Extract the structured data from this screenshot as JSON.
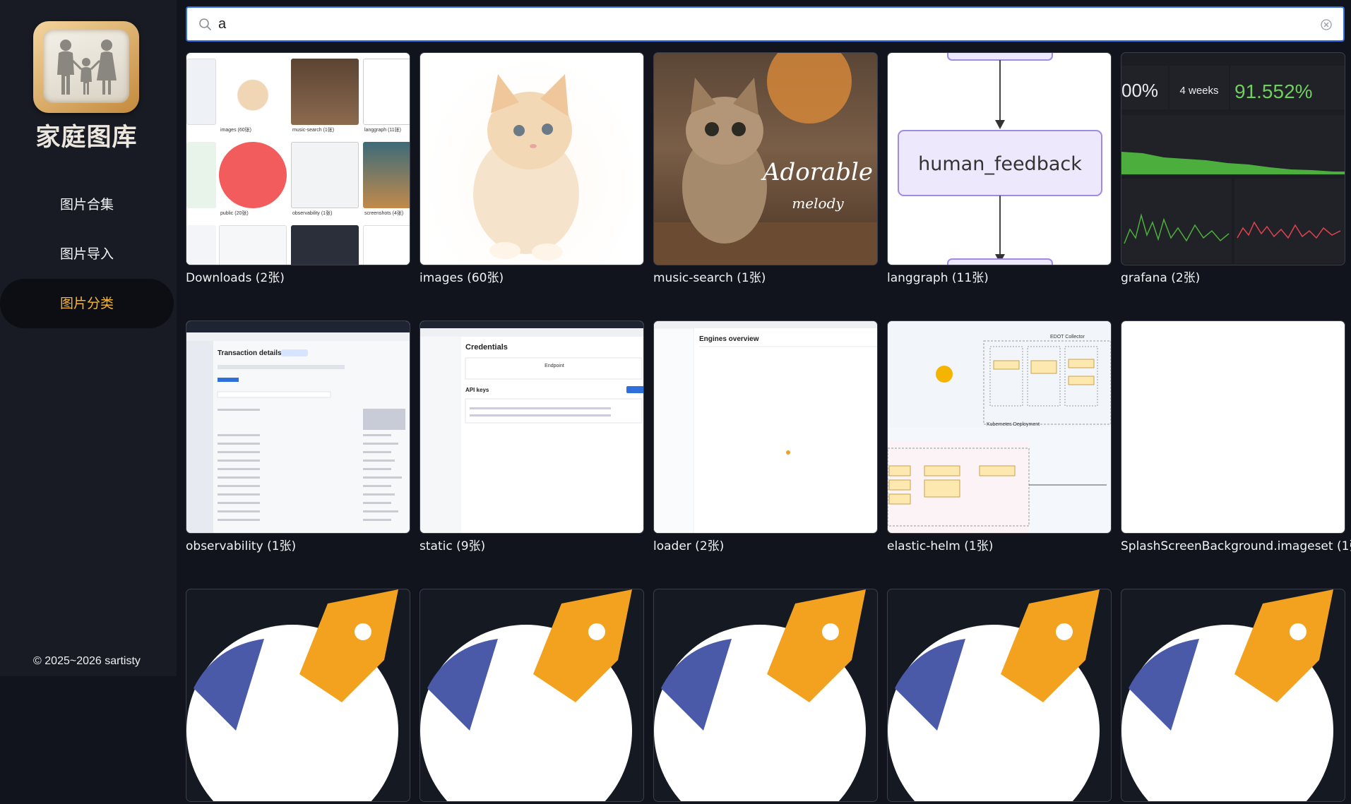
{
  "app": {
    "logo_text": "家庭图库",
    "copyright": "© 2025~2026 sartisty"
  },
  "nav": {
    "items": [
      {
        "label": "图片合集"
      },
      {
        "label": "图片导入"
      },
      {
        "label": "图片分类"
      }
    ],
    "active_index": 2
  },
  "search": {
    "value": "a",
    "placeholder": ""
  },
  "albums": [
    {
      "caption": "Downloads (2张)"
    },
    {
      "caption": "images (60张)"
    },
    {
      "caption": "music-search (1张)"
    },
    {
      "caption": "langgraph (11张)"
    },
    {
      "caption": "grafana (2张)"
    },
    {
      "caption": "observability (1张)"
    },
    {
      "caption": "static (9张)"
    },
    {
      "caption": "loader (2张)"
    },
    {
      "caption": "elastic-helm (1张)"
    },
    {
      "caption": "SplashScreenBackground.imageset (1张)"
    },
    {
      "caption": ""
    },
    {
      "caption": ""
    },
    {
      "caption": ""
    },
    {
      "caption": ""
    },
    {
      "caption": ""
    }
  ],
  "thumb_text": {
    "downloads_tiles": [
      "images (60张)",
      "music-search (1张)",
      "langgraph (11张)",
      "public (20张)",
      "observability (1张)",
      "screenshots (4张)"
    ],
    "human_feedback": "human_feedback",
    "grafana_a": "00%",
    "grafana_b": "4 weeks",
    "grafana_c": "91.552%",
    "adorable": "Adorable",
    "melody": "melody",
    "tx_title": "Transaction details",
    "credentials": "Credentials",
    "api_keys": "API keys",
    "endpoint": "Endpoint",
    "engines": "Engines overview",
    "edot": "EDOT Collector",
    "k8s": "Kubernetes Deployment"
  },
  "colors": {
    "accent": "#f7b733",
    "search_border": "#2f6fdb",
    "sidebar_bg": "#181b23",
    "main_bg": "#11141c"
  }
}
